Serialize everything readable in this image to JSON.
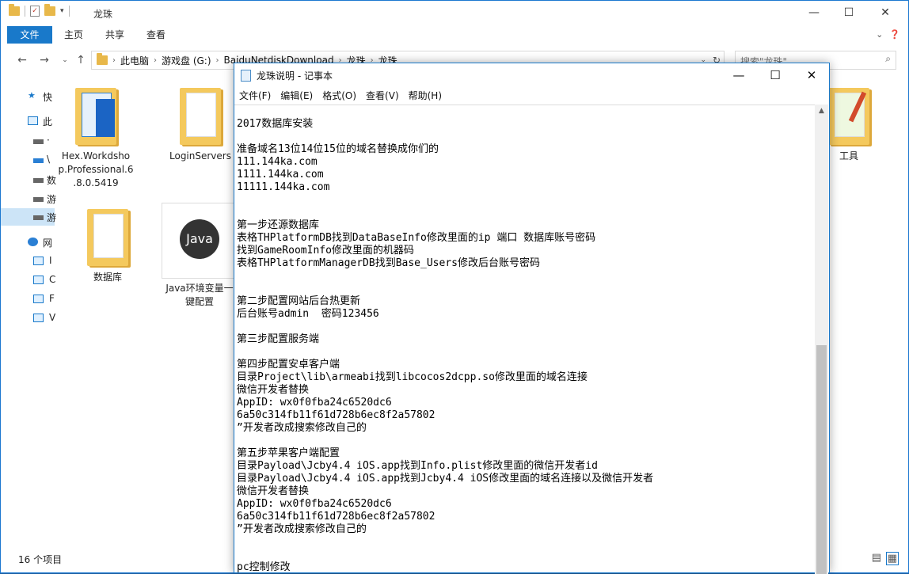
{
  "explorer": {
    "title": "龙珠",
    "tabs": [
      "文件",
      "主页",
      "共享",
      "查看"
    ],
    "address_crumbs": [
      "此电脑",
      "游戏盘 (G:)",
      "BaiduNetdiskDownload",
      "龙珠",
      "龙珠"
    ],
    "search_placeholder": "搜索\"龙珠\"",
    "sidebar": [
      {
        "label": "快",
        "icon": "star-icon"
      },
      {
        "label": "此",
        "icon": "computer-icon"
      },
      {
        "label": "·",
        "icon": "drive-icon"
      },
      {
        "label": "\\",
        "icon": "drive-icon"
      },
      {
        "label": "数",
        "icon": "drive-icon"
      },
      {
        "label": "游",
        "icon": "drive-icon"
      },
      {
        "label": "游",
        "icon": "drive-icon"
      },
      {
        "label": "网",
        "icon": "network-icon"
      },
      {
        "label": "I",
        "icon": "computer-icon"
      },
      {
        "label": "C",
        "icon": "computer-icon"
      },
      {
        "label": "F",
        "icon": "computer-icon"
      },
      {
        "label": "V",
        "icon": "computer-icon"
      }
    ],
    "items": [
      {
        "name": "Hex.Workdshop.Professional.6.8.0.5419",
        "line1": "Hex.Workdsho",
        "line2": "p.Professional.6",
        "line3": ".8.0.5419"
      },
      {
        "name": "LoginServers",
        "line1": "LoginServers"
      },
      {
        "name": "数据库",
        "line1": "数据库"
      },
      {
        "name": "Java环境变量一键配置",
        "line1": "Java环境变量一",
        "line2": "键配置",
        "badge": "Java"
      },
      {
        "name": "工具",
        "line1": "工具"
      }
    ],
    "status": "16 个项目"
  },
  "notepad": {
    "title": "龙珠说明 - 记事本",
    "menu": [
      "文件(F)",
      "编辑(E)",
      "格式(O)",
      "查看(V)",
      "帮助(H)"
    ],
    "lines": [
      "2017数据库安装",
      "",
      "准备域名13位14位15位的域名替换成你们的",
      "111.144ka.com",
      "1111.144ka.com",
      "11111.144ka.com",
      "",
      "",
      "第一步还源数据库",
      "表格THPlatformDB找到DataBaseInfo修改里面的ip 端口 数据库账号密码",
      "找到GameRoomInfo修改里面的机器码",
      "表格THPlatformManagerDB找到Base_Users修改后台账号密码",
      "",
      "",
      "第二步配置网站后台热更新",
      "后台账号admin  密码123456",
      "",
      "第三步配置服务端",
      "",
      "第四步配置安卓客户端",
      "目录Project\\lib\\armeabi找到libcocos2dcpp.so修改里面的域名连接",
      "微信开发者替换",
      "AppID: wx0f0fba24c6520dc6",
      "6a50c314fb11f61d728b6ec8f2a57802",
      "”开发者改成搜索修改自己的",
      "",
      "第五步苹果客户端配置",
      "目录Payload\\Jcby4.4 iOS.app找到Info.plist修改里面的微信开发者id",
      "目录Payload\\Jcby4.4 iOS.app找到Jcby4.4 iOS修改里面的域名连接以及微信开发者",
      "微信开发者替换",
      "AppID: wx0f0fba24c6520dc6",
      "6a50c314fb11f61d728b6ec8f2a57802",
      "”开发者改成搜索修改自己的",
      "",
      "",
      "pc控制修改"
    ]
  }
}
